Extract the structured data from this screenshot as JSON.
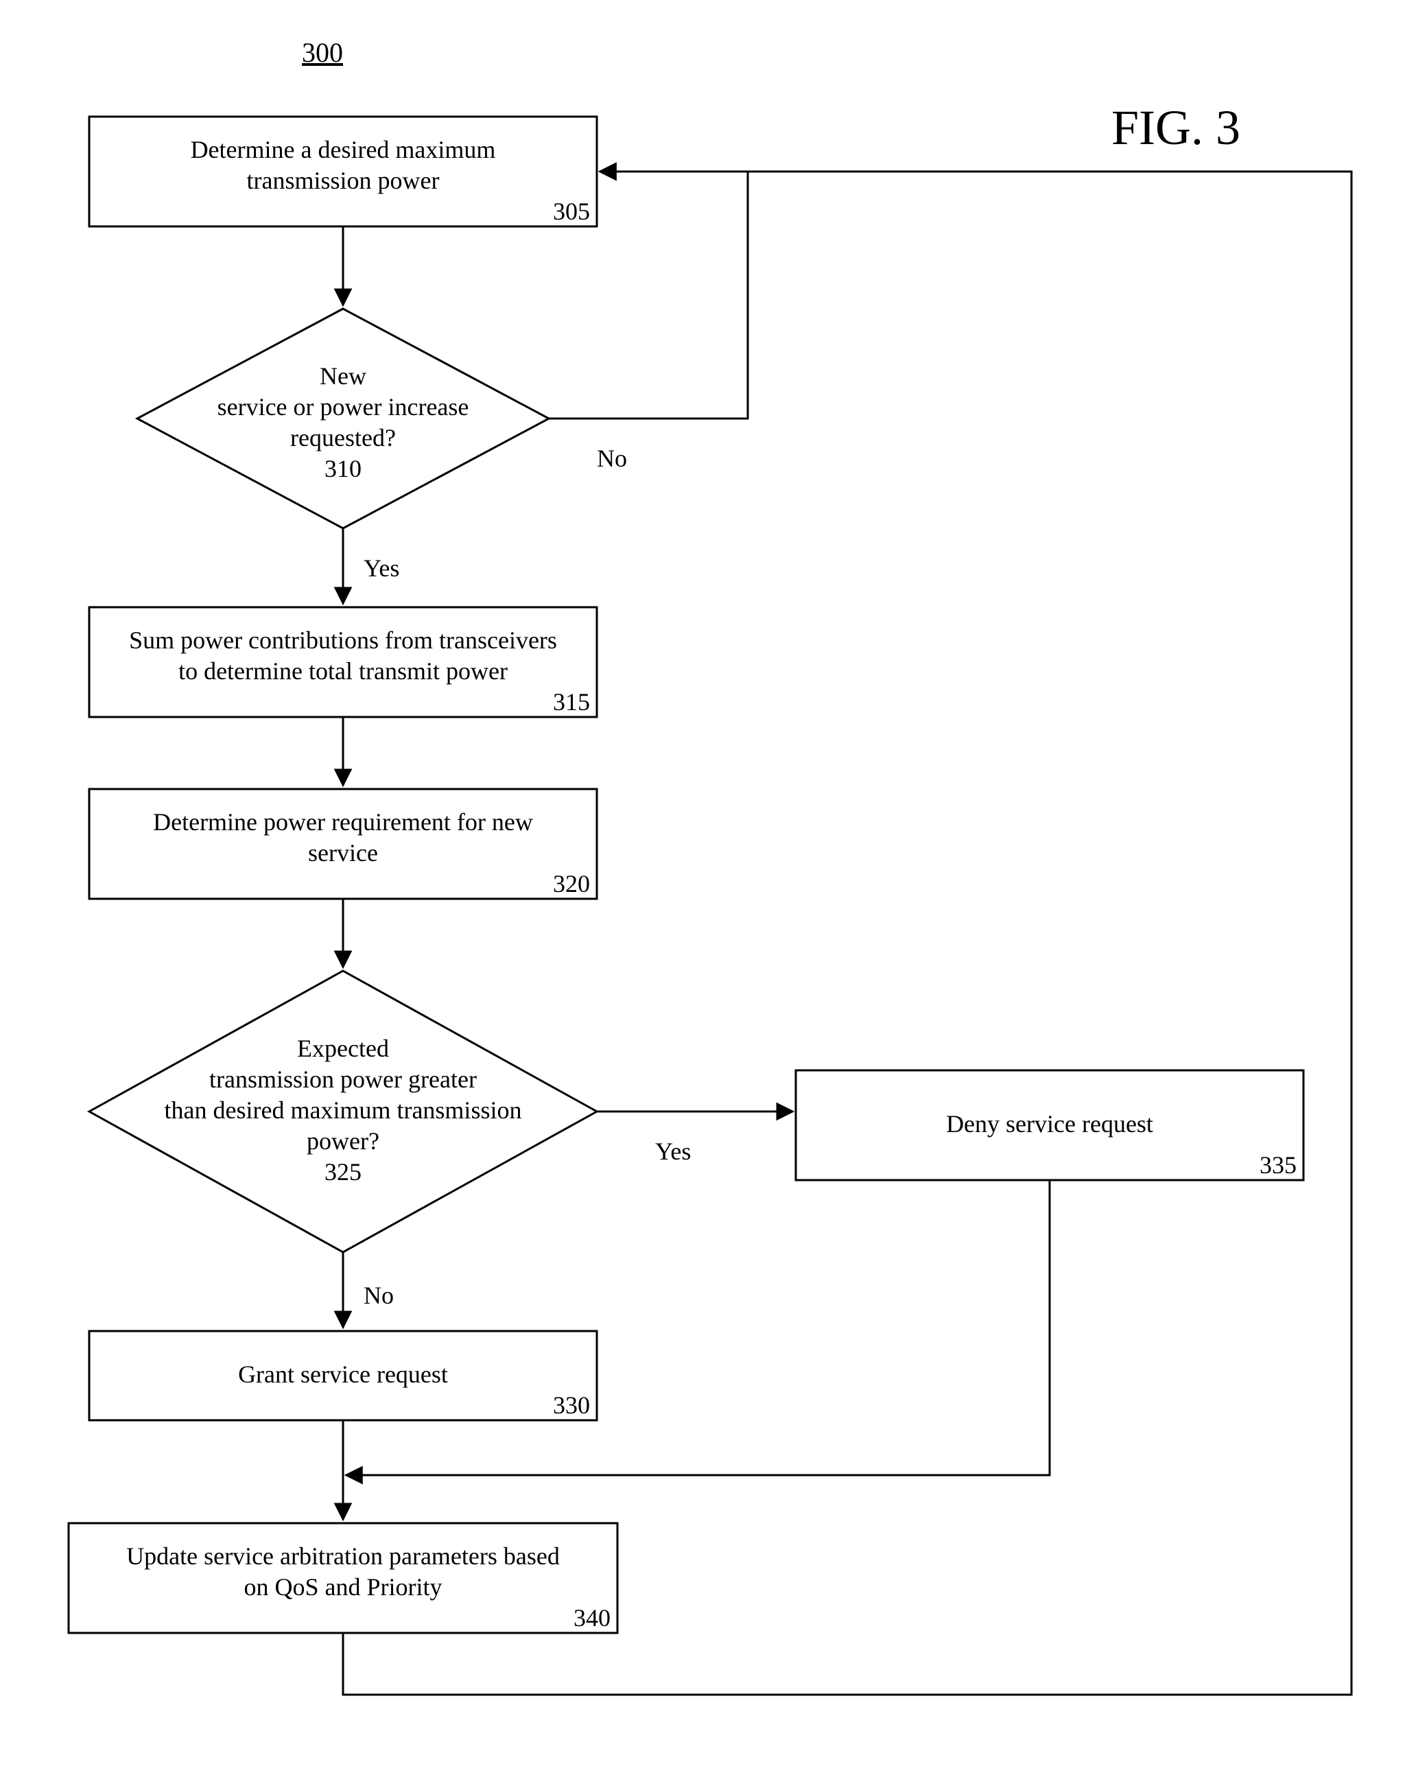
{
  "figure": {
    "number_label": "300",
    "title": "FIG. 3"
  },
  "nodes": {
    "n305": {
      "lines": [
        "Determine a desired maximum",
        "transmission power"
      ],
      "ref": "305"
    },
    "n310": {
      "lines": [
        "New",
        "service or power increase",
        "requested?"
      ],
      "ref": "310"
    },
    "n315": {
      "lines": [
        "Sum power contributions from transceivers",
        "to determine total transmit power"
      ],
      "ref": "315"
    },
    "n320": {
      "lines": [
        "Determine power requirement for new",
        "service"
      ],
      "ref": "320"
    },
    "n325": {
      "lines": [
        "Expected",
        "transmission power greater",
        "than desired maximum transmission",
        "power?"
      ],
      "ref": "325"
    },
    "n330": {
      "lines": [
        "Grant service request"
      ],
      "ref": "330"
    },
    "n335": {
      "lines": [
        "Deny service request"
      ],
      "ref": "335"
    },
    "n340": {
      "lines": [
        "Update service arbitration parameters based",
        "on QoS and Priority"
      ],
      "ref": "340"
    }
  },
  "edges": {
    "e310_no": "No",
    "e310_yes": "Yes",
    "e325_yes": "Yes",
    "e325_no": "No"
  }
}
